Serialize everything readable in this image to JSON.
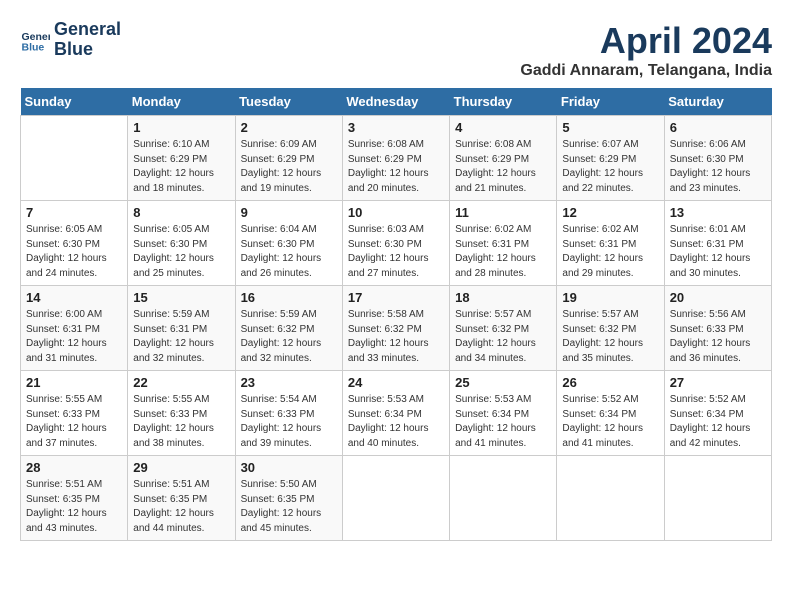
{
  "logo": {
    "line1": "General",
    "line2": "Blue"
  },
  "title": "April 2024",
  "location": "Gaddi Annaram, Telangana, India",
  "days_of_week": [
    "Sunday",
    "Monday",
    "Tuesday",
    "Wednesday",
    "Thursday",
    "Friday",
    "Saturday"
  ],
  "weeks": [
    [
      {
        "day": "",
        "sunrise": "",
        "sunset": "",
        "daylight": ""
      },
      {
        "day": "1",
        "sunrise": "Sunrise: 6:10 AM",
        "sunset": "Sunset: 6:29 PM",
        "daylight": "Daylight: 12 hours and 18 minutes."
      },
      {
        "day": "2",
        "sunrise": "Sunrise: 6:09 AM",
        "sunset": "Sunset: 6:29 PM",
        "daylight": "Daylight: 12 hours and 19 minutes."
      },
      {
        "day": "3",
        "sunrise": "Sunrise: 6:08 AM",
        "sunset": "Sunset: 6:29 PM",
        "daylight": "Daylight: 12 hours and 20 minutes."
      },
      {
        "day": "4",
        "sunrise": "Sunrise: 6:08 AM",
        "sunset": "Sunset: 6:29 PM",
        "daylight": "Daylight: 12 hours and 21 minutes."
      },
      {
        "day": "5",
        "sunrise": "Sunrise: 6:07 AM",
        "sunset": "Sunset: 6:29 PM",
        "daylight": "Daylight: 12 hours and 22 minutes."
      },
      {
        "day": "6",
        "sunrise": "Sunrise: 6:06 AM",
        "sunset": "Sunset: 6:30 PM",
        "daylight": "Daylight: 12 hours and 23 minutes."
      }
    ],
    [
      {
        "day": "7",
        "sunrise": "Sunrise: 6:05 AM",
        "sunset": "Sunset: 6:30 PM",
        "daylight": "Daylight: 12 hours and 24 minutes."
      },
      {
        "day": "8",
        "sunrise": "Sunrise: 6:05 AM",
        "sunset": "Sunset: 6:30 PM",
        "daylight": "Daylight: 12 hours and 25 minutes."
      },
      {
        "day": "9",
        "sunrise": "Sunrise: 6:04 AM",
        "sunset": "Sunset: 6:30 PM",
        "daylight": "Daylight: 12 hours and 26 minutes."
      },
      {
        "day": "10",
        "sunrise": "Sunrise: 6:03 AM",
        "sunset": "Sunset: 6:30 PM",
        "daylight": "Daylight: 12 hours and 27 minutes."
      },
      {
        "day": "11",
        "sunrise": "Sunrise: 6:02 AM",
        "sunset": "Sunset: 6:31 PM",
        "daylight": "Daylight: 12 hours and 28 minutes."
      },
      {
        "day": "12",
        "sunrise": "Sunrise: 6:02 AM",
        "sunset": "Sunset: 6:31 PM",
        "daylight": "Daylight: 12 hours and 29 minutes."
      },
      {
        "day": "13",
        "sunrise": "Sunrise: 6:01 AM",
        "sunset": "Sunset: 6:31 PM",
        "daylight": "Daylight: 12 hours and 30 minutes."
      }
    ],
    [
      {
        "day": "14",
        "sunrise": "Sunrise: 6:00 AM",
        "sunset": "Sunset: 6:31 PM",
        "daylight": "Daylight: 12 hours and 31 minutes."
      },
      {
        "day": "15",
        "sunrise": "Sunrise: 5:59 AM",
        "sunset": "Sunset: 6:31 PM",
        "daylight": "Daylight: 12 hours and 32 minutes."
      },
      {
        "day": "16",
        "sunrise": "Sunrise: 5:59 AM",
        "sunset": "Sunset: 6:32 PM",
        "daylight": "Daylight: 12 hours and 32 minutes."
      },
      {
        "day": "17",
        "sunrise": "Sunrise: 5:58 AM",
        "sunset": "Sunset: 6:32 PM",
        "daylight": "Daylight: 12 hours and 33 minutes."
      },
      {
        "day": "18",
        "sunrise": "Sunrise: 5:57 AM",
        "sunset": "Sunset: 6:32 PM",
        "daylight": "Daylight: 12 hours and 34 minutes."
      },
      {
        "day": "19",
        "sunrise": "Sunrise: 5:57 AM",
        "sunset": "Sunset: 6:32 PM",
        "daylight": "Daylight: 12 hours and 35 minutes."
      },
      {
        "day": "20",
        "sunrise": "Sunrise: 5:56 AM",
        "sunset": "Sunset: 6:33 PM",
        "daylight": "Daylight: 12 hours and 36 minutes."
      }
    ],
    [
      {
        "day": "21",
        "sunrise": "Sunrise: 5:55 AM",
        "sunset": "Sunset: 6:33 PM",
        "daylight": "Daylight: 12 hours and 37 minutes."
      },
      {
        "day": "22",
        "sunrise": "Sunrise: 5:55 AM",
        "sunset": "Sunset: 6:33 PM",
        "daylight": "Daylight: 12 hours and 38 minutes."
      },
      {
        "day": "23",
        "sunrise": "Sunrise: 5:54 AM",
        "sunset": "Sunset: 6:33 PM",
        "daylight": "Daylight: 12 hours and 39 minutes."
      },
      {
        "day": "24",
        "sunrise": "Sunrise: 5:53 AM",
        "sunset": "Sunset: 6:34 PM",
        "daylight": "Daylight: 12 hours and 40 minutes."
      },
      {
        "day": "25",
        "sunrise": "Sunrise: 5:53 AM",
        "sunset": "Sunset: 6:34 PM",
        "daylight": "Daylight: 12 hours and 41 minutes."
      },
      {
        "day": "26",
        "sunrise": "Sunrise: 5:52 AM",
        "sunset": "Sunset: 6:34 PM",
        "daylight": "Daylight: 12 hours and 41 minutes."
      },
      {
        "day": "27",
        "sunrise": "Sunrise: 5:52 AM",
        "sunset": "Sunset: 6:34 PM",
        "daylight": "Daylight: 12 hours and 42 minutes."
      }
    ],
    [
      {
        "day": "28",
        "sunrise": "Sunrise: 5:51 AM",
        "sunset": "Sunset: 6:35 PM",
        "daylight": "Daylight: 12 hours and 43 minutes."
      },
      {
        "day": "29",
        "sunrise": "Sunrise: 5:51 AM",
        "sunset": "Sunset: 6:35 PM",
        "daylight": "Daylight: 12 hours and 44 minutes."
      },
      {
        "day": "30",
        "sunrise": "Sunrise: 5:50 AM",
        "sunset": "Sunset: 6:35 PM",
        "daylight": "Daylight: 12 hours and 45 minutes."
      },
      {
        "day": "",
        "sunrise": "",
        "sunset": "",
        "daylight": ""
      },
      {
        "day": "",
        "sunrise": "",
        "sunset": "",
        "daylight": ""
      },
      {
        "day": "",
        "sunrise": "",
        "sunset": "",
        "daylight": ""
      },
      {
        "day": "",
        "sunrise": "",
        "sunset": "",
        "daylight": ""
      }
    ]
  ]
}
